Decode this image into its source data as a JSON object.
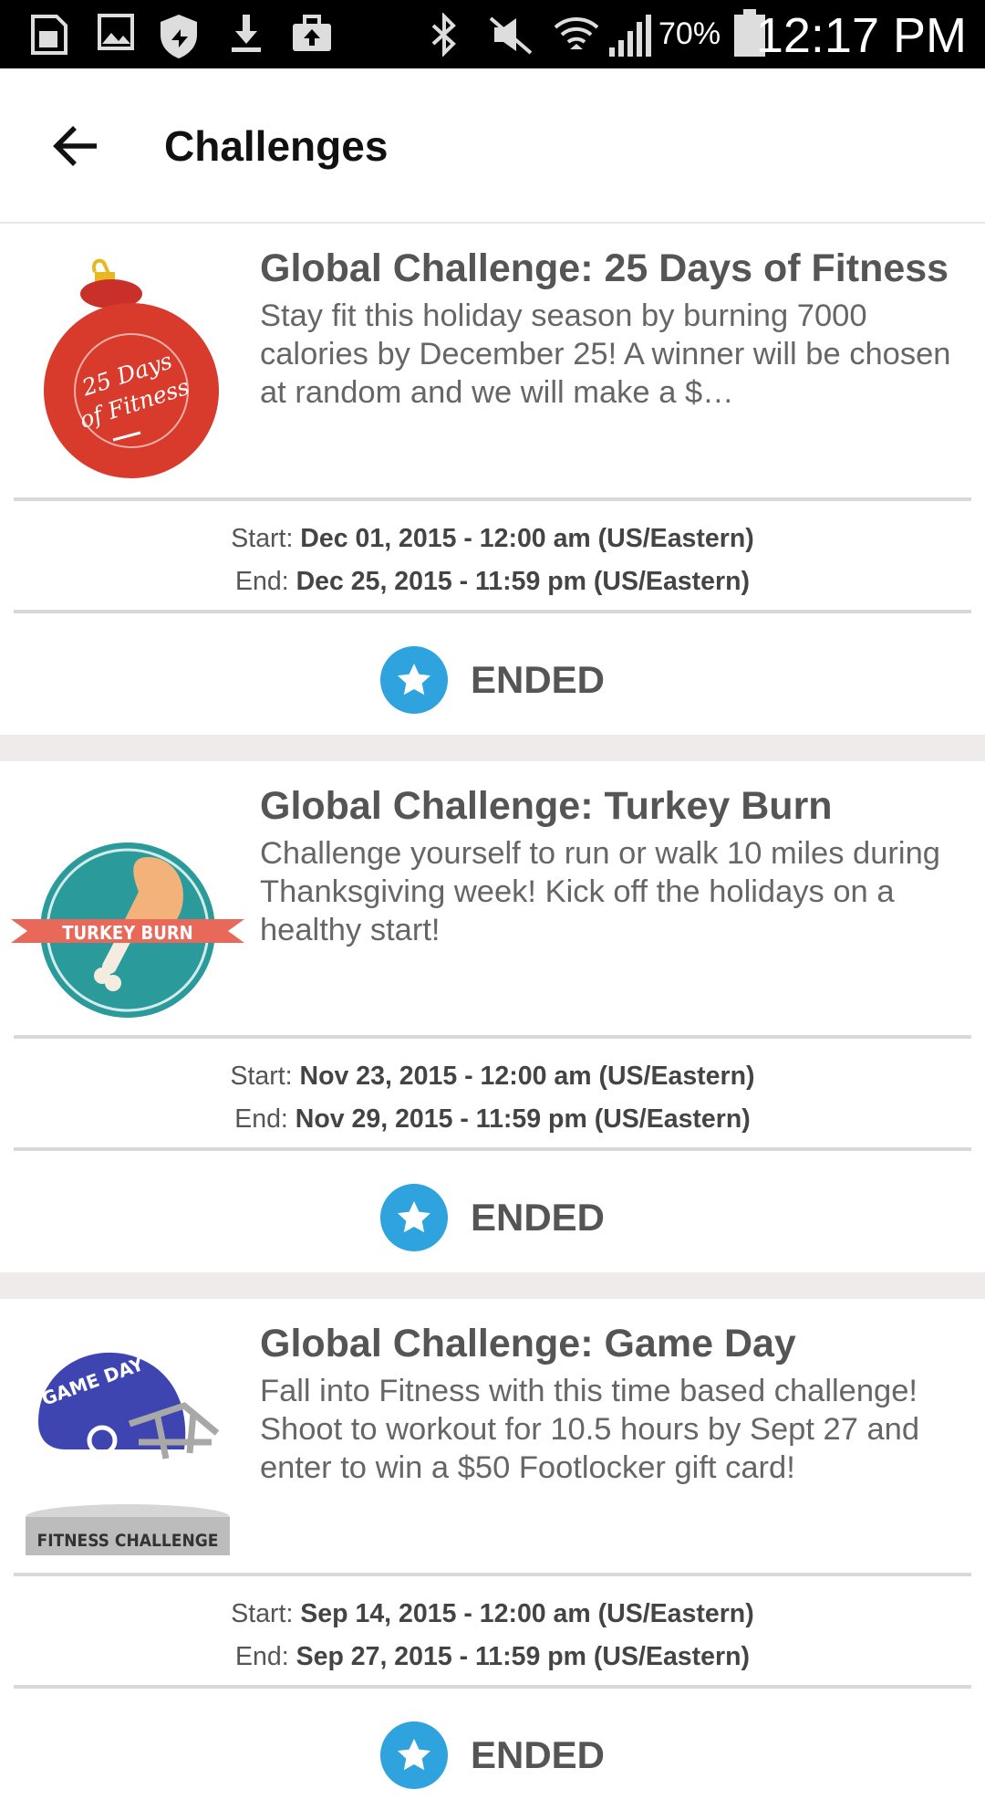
{
  "status_bar": {
    "battery": "70%",
    "time": "12:17 PM"
  },
  "header": {
    "title": "Challenges"
  },
  "labels": {
    "start": "Start:",
    "end": "End:"
  },
  "challenges": [
    {
      "title": "Global Challenge: 25 Days of Fitness",
      "description": "Stay fit this holiday season by burning 7000 calories by December 25! A winner will be chosen at random and we will make a $…",
      "start": "Dec 01, 2015 - 12:00 am (US/Eastern)",
      "end": "Dec 25, 2015 - 11:59 pm (US/Eastern)",
      "status": "ENDED",
      "badge_text_1": "25 Days",
      "badge_text_2": "of Fitness"
    },
    {
      "title": "Global Challenge: Turkey Burn",
      "description": "Challenge yourself to run or walk 10 miles during Thanksgiving week! Kick off the holidays on a healthy start!",
      "start": "Nov 23, 2015 - 12:00 am (US/Eastern)",
      "end": "Nov 29, 2015 - 11:59 pm (US/Eastern)",
      "status": "ENDED",
      "badge_text_1": "TURKEY BURN"
    },
    {
      "title": "Global Challenge: Game Day",
      "description": "Fall into Fitness with this time based challenge! Shoot to workout for 10.5 hours by Sept 27 and enter to win a $50 Footlocker gift card!",
      "start": "Sep 14, 2015 - 12:00 am (US/Eastern)",
      "end": "Sep 27, 2015 - 11:59 pm (US/Eastern)",
      "status": "ENDED",
      "badge_text_1": "GAME DAY",
      "badge_text_2": "FITNESS CHALLENGE"
    }
  ],
  "colors": {
    "accent": "#2ea3dd",
    "ornament_red": "#d83a2c",
    "turkey_teal": "#2a9a9a",
    "helmet_blue": "#3f45b0"
  }
}
